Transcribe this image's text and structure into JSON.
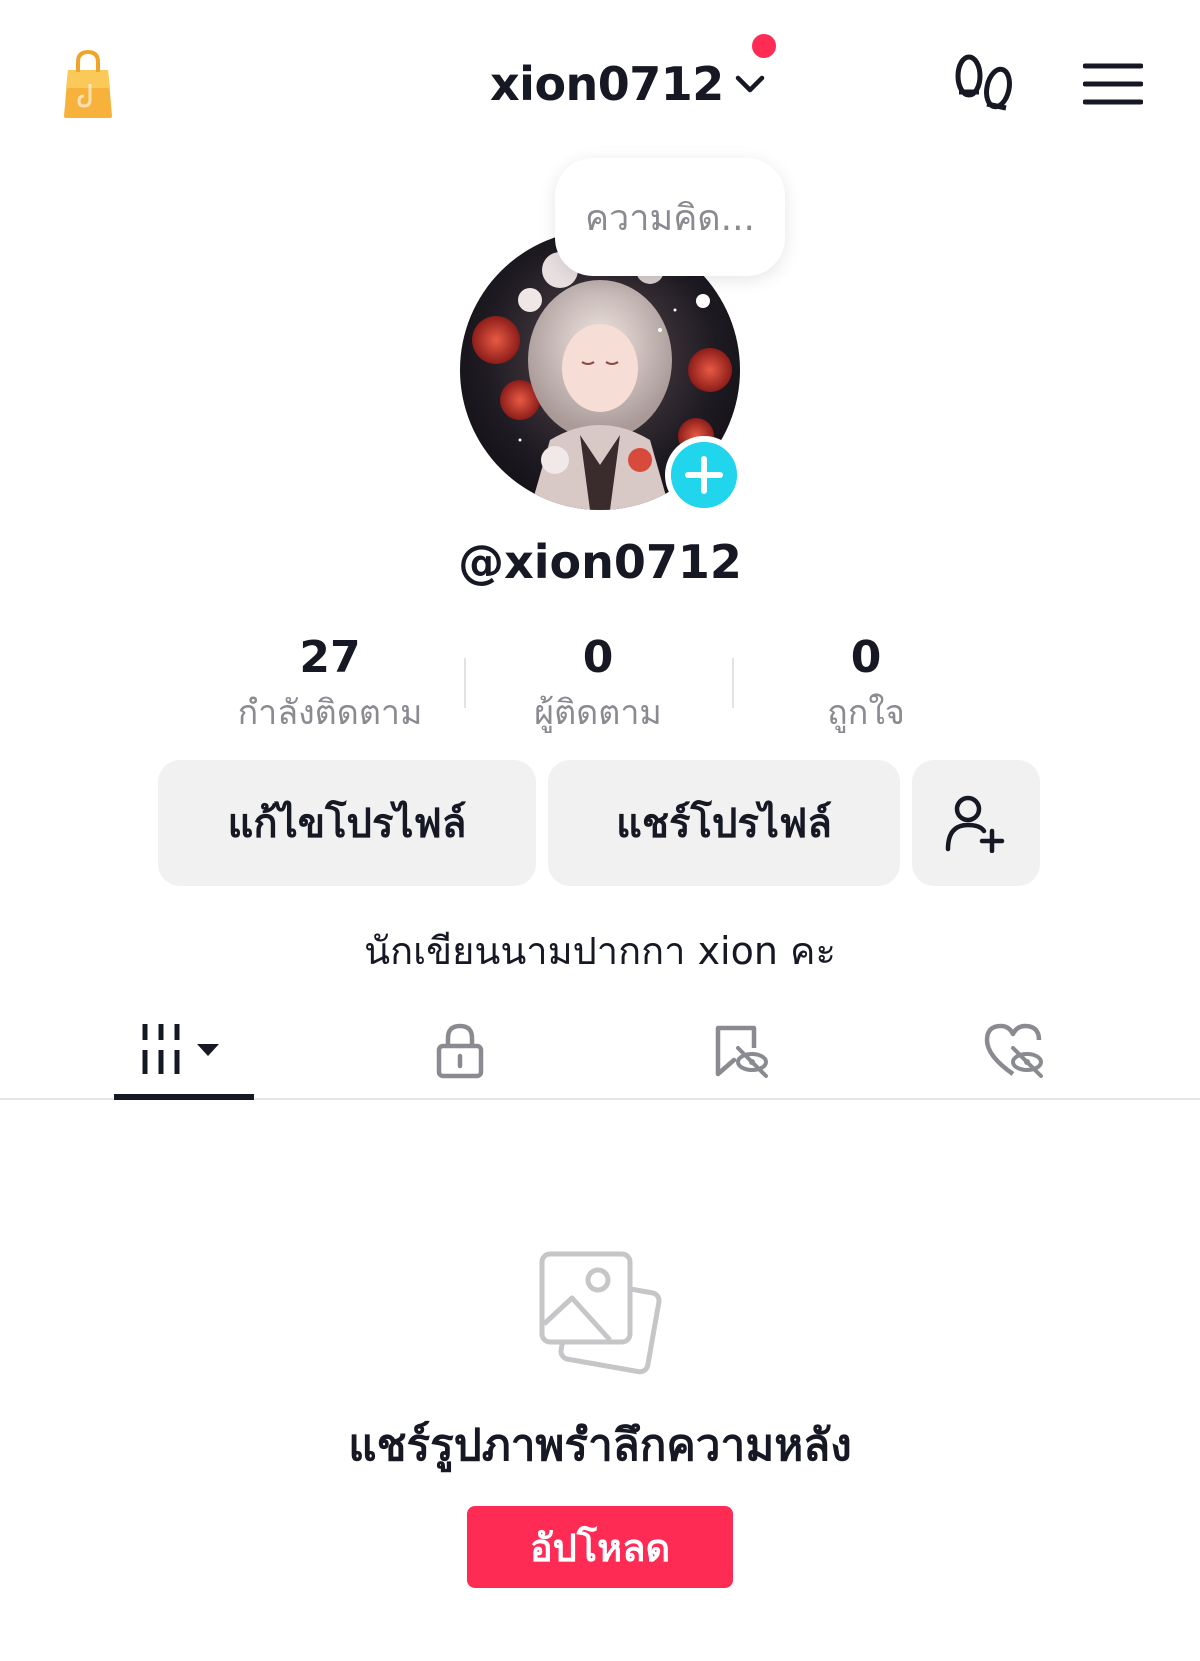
{
  "colors": {
    "accent": "#fe2c55",
    "badge": "#20d5ec",
    "text_primary": "#161823",
    "text_secondary": "#8a8b91",
    "button_bg": "#f1f1f2",
    "shop_bag": "#f7b23b"
  },
  "header": {
    "username": "xion0712",
    "icons": [
      "shop-bag-icon",
      "chevron-down-icon",
      "notification-dot",
      "footprint-icon",
      "menu-icon"
    ]
  },
  "profile": {
    "thought_bubble": "ความคิด...",
    "handle": "@xion0712",
    "bio": "นักเขียนนามปากกา xion คะ"
  },
  "stats": [
    {
      "value": "27",
      "label": "กำลังติดตาม"
    },
    {
      "value": "0",
      "label": "ผู้ติดตาม"
    },
    {
      "value": "0",
      "label": "ถูกใจ"
    }
  ],
  "actions": {
    "edit_label": "แก้ไขโปรไฟล์",
    "share_label": "แชร์โปรไฟล์",
    "add_friend_icon": "add-friend-icon"
  },
  "tabs": [
    {
      "icon": "videos-grid-icon",
      "active": true
    },
    {
      "icon": "lock-icon",
      "active": false
    },
    {
      "icon": "hidden-repost-icon",
      "active": false
    },
    {
      "icon": "hidden-liked-icon",
      "active": false
    }
  ],
  "empty_state": {
    "icon": "photos-icon",
    "title": "แชร์รูปภาพรำลึกความหลัง",
    "upload_label": "อัปโหลด"
  }
}
